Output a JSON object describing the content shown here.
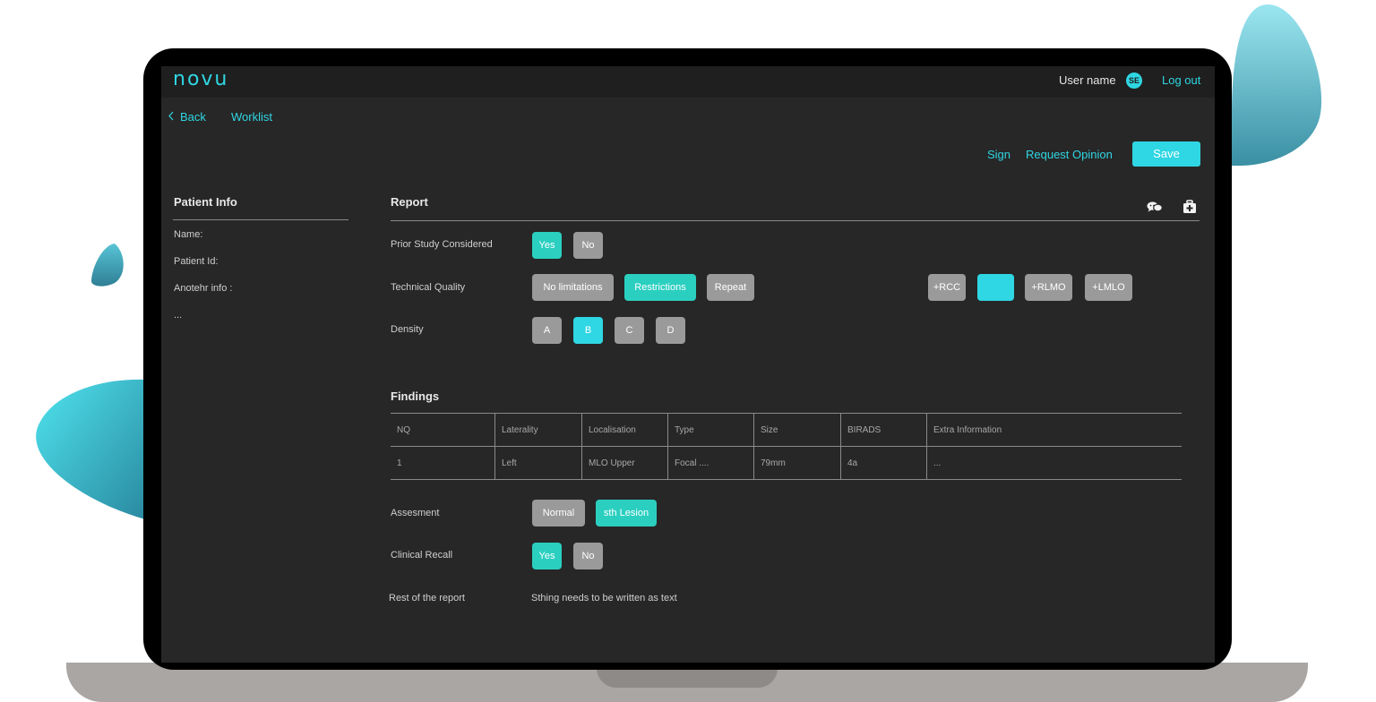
{
  "app": {
    "logo": "novu"
  },
  "header": {
    "user_name": "User name",
    "avatar_initials": "SE",
    "logout_label": "Log out"
  },
  "nav": {
    "back_label": "Back",
    "worklist_label": "Worklist"
  },
  "actions": {
    "sign_label": "Sign",
    "request_opinion_label": "Request Opinion",
    "save_label": "Save"
  },
  "patient_info": {
    "title": "Patient Info",
    "fields": [
      "Name:",
      "Patient Id:",
      "Anotehr info :",
      "..."
    ]
  },
  "report": {
    "title": "Report",
    "prior_study": {
      "label": "Prior Study Considered",
      "options": [
        "Yes",
        "No"
      ],
      "selected": "Yes"
    },
    "technical_quality": {
      "label": "Technical Quality",
      "options": [
        "No limitations",
        "Restrictions",
        "Repeat"
      ],
      "selected": "Restrictions",
      "views": [
        "+RCC",
        "",
        "+RLMO",
        "+LMLO"
      ]
    },
    "density": {
      "label": "Density",
      "options": [
        "A",
        "B",
        "C",
        "D"
      ],
      "selected": "B"
    }
  },
  "findings": {
    "title": "Findings",
    "columns": [
      "NQ",
      "Laterality",
      "Localisation",
      "Type",
      "Size",
      "BIRADS",
      "Extra Information"
    ],
    "rows": [
      [
        "1",
        "Left",
        "MLO Upper",
        "Focal ....",
        "79mm",
        "4a",
        "..."
      ]
    ]
  },
  "assessment": {
    "label": "Assesment",
    "options": [
      "Normal",
      "sth Lesion"
    ],
    "selected": "sth Lesion"
  },
  "clinical_recall": {
    "label": "Clinical Recall",
    "options": [
      "Yes",
      "No"
    ],
    "selected": "Yes"
  },
  "rest_of_report": {
    "label": "Rest of the report",
    "text": "Sthing needs to be written as text"
  },
  "colors": {
    "accent": "#2fd6e3",
    "teal": "#2bcfc0",
    "background": "#272727",
    "chip_gray": "#9a9a9a"
  },
  "icons": [
    "chevron-left-icon",
    "chat-icon",
    "medical-kit-icon"
  ]
}
